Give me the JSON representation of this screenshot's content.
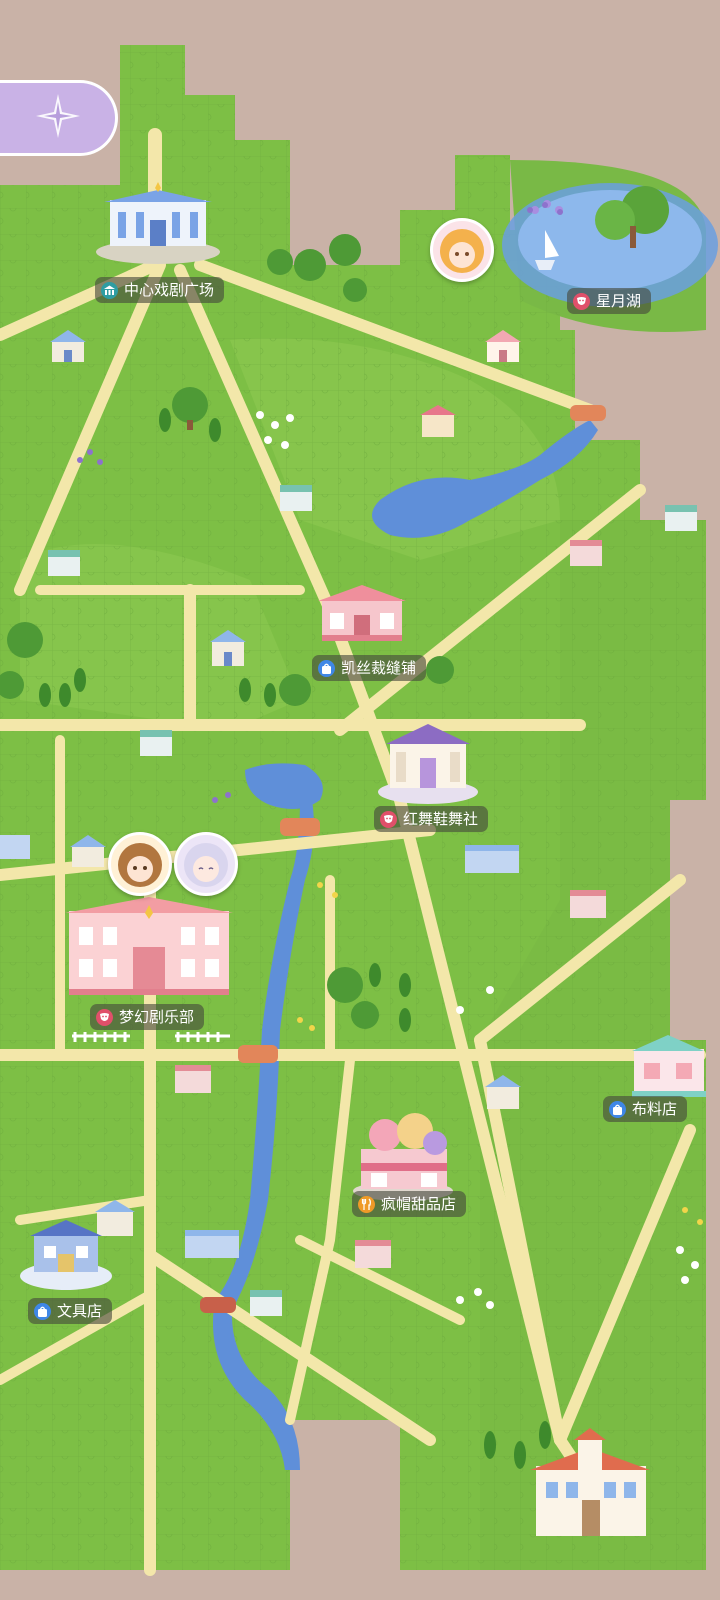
{
  "map": {
    "locations": [
      {
        "key": "central-plaza",
        "name": "中心戏剧广场",
        "icon": "hall-icon"
      },
      {
        "key": "star-moon-lake",
        "name": "星月湖",
        "icon": "theater-mask-icon"
      },
      {
        "key": "kaisi-tailor",
        "name": "凯丝裁缝铺",
        "icon": "shopping-bag-icon"
      },
      {
        "key": "red-dance-shoes",
        "name": "红舞鞋舞社",
        "icon": "theater-mask-icon"
      },
      {
        "key": "dream-theater-club",
        "name": "梦幻剧乐部",
        "icon": "theater-mask-icon"
      },
      {
        "key": "fabric-shop",
        "name": "布料店",
        "icon": "shopping-bag-icon"
      },
      {
        "key": "mad-hatter-dessert",
        "name": "疯帽甜品店",
        "icon": "fork-knife-icon"
      },
      {
        "key": "stationery-store",
        "name": "文具店",
        "icon": "shopping-bag-icon"
      }
    ],
    "colors": {
      "grass": "#7dbf45",
      "grass_light": "#9ed25c",
      "road": "#f3e7aa",
      "river": "#5f8fd9",
      "background": "#c9b2a7",
      "compass_button": "#c9b2e6"
    },
    "compass_icon": "compass-icon"
  }
}
